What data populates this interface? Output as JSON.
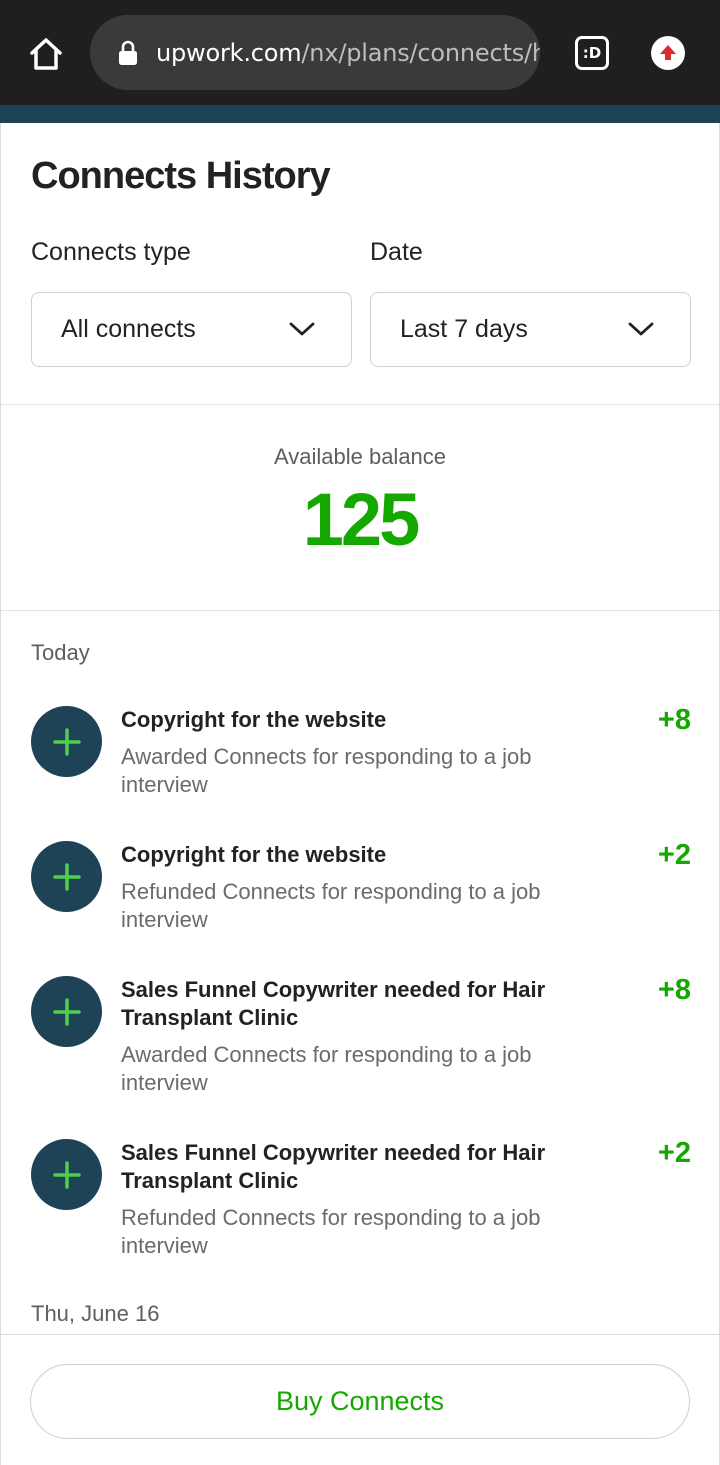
{
  "browser": {
    "url_host": "upwork.com",
    "url_path": "/nx/plans/connects/hi",
    "tabs_label": ":D"
  },
  "page": {
    "title": "Connects History"
  },
  "filters": {
    "type_label": "Connects type",
    "type_value": "All connects",
    "date_label": "Date",
    "date_value": "Last 7 days"
  },
  "balance": {
    "label": "Available balance",
    "value": "125"
  },
  "sections": [
    {
      "date": "Today",
      "items": [
        {
          "title": "Copyright for the website",
          "desc": "Awarded Connects for responding to a job interview",
          "amount": "+8"
        },
        {
          "title": "Copyright for the website",
          "desc": "Refunded Connects for responding to a job interview",
          "amount": "+2"
        },
        {
          "title": "Sales Funnel Copywriter needed for Hair Transplant Clinic",
          "desc": "Awarded Connects for responding to a job interview",
          "amount": "+8"
        },
        {
          "title": "Sales Funnel Copywriter needed for Hair Transplant Clinic",
          "desc": "Refunded Connects for responding to a job interview",
          "amount": "+2"
        }
      ]
    },
    {
      "date": "Thu, June 16",
      "items": []
    }
  ],
  "footer": {
    "buy_label": "Buy Connects"
  },
  "colors": {
    "accent_green": "#14a800",
    "icon_navy": "#1e4356",
    "icon_plus": "#4fd04a"
  },
  "icons": {
    "home": "home-icon",
    "lock": "lock-icon",
    "upload": "upload-icon",
    "chevron": "chevron-down-icon",
    "plus": "plus-icon"
  }
}
